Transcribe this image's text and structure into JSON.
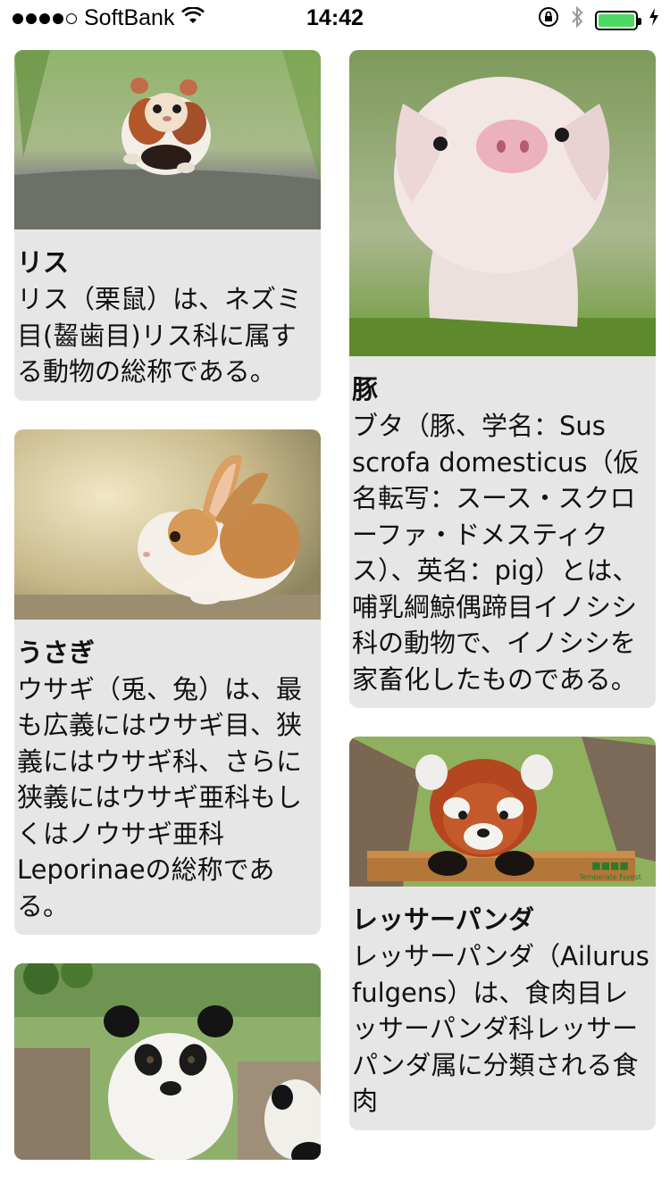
{
  "status_bar": {
    "carrier": "SoftBank",
    "time": "14:42",
    "signal_bars_filled": 4,
    "signal_bars_total": 5,
    "battery_level": 1.0,
    "battery_color": "#4cd964"
  },
  "cards_left": [
    {
      "title": "リス",
      "description": "リス（栗鼠）は、ネズミ目(齧歯目)リス科に属する動物の総称である。",
      "photo": "hamster-photo"
    },
    {
      "title": "うさぎ",
      "description": "ウサギ（兎、兔）は、最も広義にはウサギ目、狭義にはウサギ科、さらに狭義にはウサギ亜科もしくはノウサギ亜科 Leporinaeの総称である。",
      "photo": "rabbit-photo"
    },
    {
      "title": "",
      "description": "",
      "photo": "panda-photo"
    }
  ],
  "cards_right": [
    {
      "title": "豚",
      "description": "ブタ（豚、学名：Sus scrofa domesticus（仮名転写：スース・スクローファ・ドメスティクス）、英名：pig）とは、哺乳綱鯨偶蹄目イノシシ科の動物で、イノシシを家畜化したものである。",
      "photo": "pig-photo"
    },
    {
      "title": "レッサーパンダ",
      "description": "レッサーパンダ（Ailurus fulgens）は、食肉目レッサーパンダ科レッサーパンダ属に分類される食肉",
      "photo": "red-panda-photo",
      "photo_watermark": "Temperate Forest"
    }
  ]
}
